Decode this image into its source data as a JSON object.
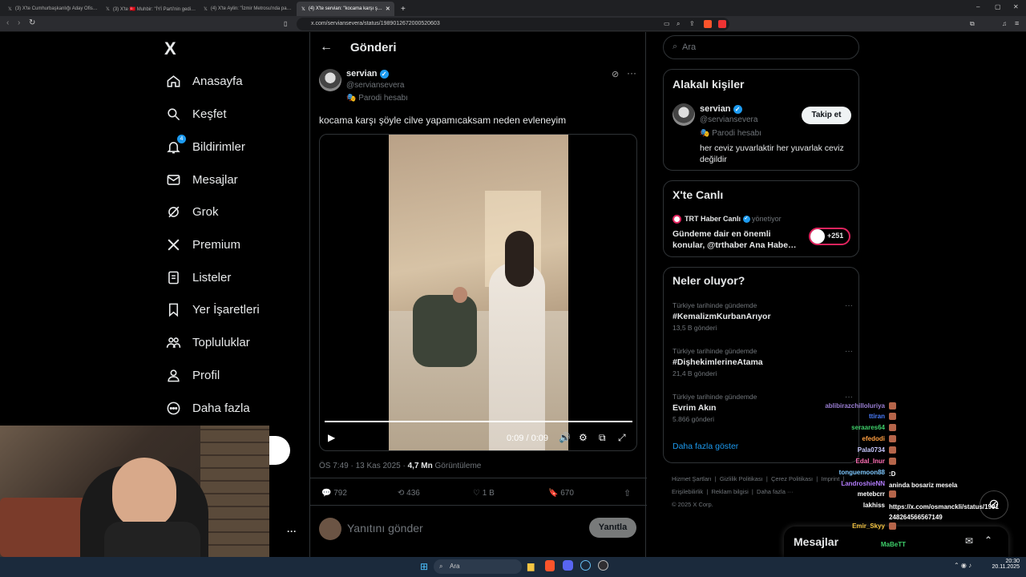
{
  "browser": {
    "tabs": [
      {
        "label": "(3) X'te Cumhurbaşkanlığı Aday Ofis…"
      },
      {
        "label": "(3) X'te  🇹🇷 Muhbir: \"İYİ Parti'nin gedi…"
      },
      {
        "label": "(4) X'te Aylin: \"İzmir Metrosu'nda pa…"
      },
      {
        "label": "(4) X'te servian: \"kocama karşı ş…"
      }
    ],
    "url": "x.com/serviansevera/status/1989012672000520603"
  },
  "nav": {
    "logo": "X",
    "items": [
      {
        "label": "Anasayfa",
        "icon": "home-icon"
      },
      {
        "label": "Keşfet",
        "icon": "search-icon"
      },
      {
        "label": "Bildirimler",
        "icon": "bell-icon",
        "badge": "4"
      },
      {
        "label": "Mesajlar",
        "icon": "mail-icon"
      },
      {
        "label": "Grok",
        "icon": "grok-icon"
      },
      {
        "label": "Premium",
        "icon": "x-icon"
      },
      {
        "label": "Listeler",
        "icon": "list-icon"
      },
      {
        "label": "Yer İşaretleri",
        "icon": "bookmark-icon"
      },
      {
        "label": "Topluluklar",
        "icon": "people-icon"
      },
      {
        "label": "Profil",
        "icon": "person-icon"
      },
      {
        "label": "Daha fazla",
        "icon": "more-circle-icon"
      }
    ]
  },
  "header": {
    "title": "Gönderi"
  },
  "post": {
    "name": "servian",
    "handle": "@serviansevera",
    "parody": "Parodi hesabı",
    "text": "kocama karşı şöyle cilve yapamıcaksam neden evleneyim",
    "video_time": "0:09 / 0:09",
    "video_progress": 1.0,
    "timestamp": "ÖS 7:49 · 13 Kas 2025 · ",
    "views": "4,7 Mn",
    "views_label": "Görüntüleme",
    "replies": "792",
    "reposts": "436",
    "likes": "1 B",
    "bookmarks": "670",
    "reply_placeholder": "Yanıtını gönder",
    "reply_button": "Yanıtla"
  },
  "search": {
    "placeholder": "Ara"
  },
  "related": {
    "title": "Alakalı kişiler",
    "name": "servian",
    "handle": "@serviansevera",
    "parody": "Parodi hesabı",
    "bio": "her ceviz yuvarlaktir her yuvarlak ceviz değildir",
    "follow": "Takip et"
  },
  "live": {
    "title": "X'te Canlı",
    "host": "TRT Haber Canlı",
    "host_role": "yönetiyor",
    "text": "Gündeme dair en önemli konular, @trthaber Ana Habe…",
    "count": "+251"
  },
  "trends": {
    "title": "Neler oluyor?",
    "items": [
      {
        "context": "Türkiye tarihinde gündemde",
        "name": "#KemalizmKurbanArıyor",
        "count": "13,5 B gönderi"
      },
      {
        "context": "Türkiye tarihinde gündemde",
        "name": "#DişhekimlerineAtama",
        "count": "21,4 B gönderi"
      },
      {
        "context": "Türkiye tarihinde gündemde",
        "name": "Evrim Akın",
        "count": "5.866 gönderi"
      }
    ],
    "show_more": "Daha fazla göster"
  },
  "footer": {
    "links": [
      "Hizmet Şartları",
      "Gizlilik Politikası",
      "Çerez Politikası",
      "Imprint",
      "Erişilebilirlik",
      "Reklam bilgisi",
      "Daha fazla ···"
    ],
    "copyright": "© 2025 X Corp."
  },
  "messages_bar": {
    "title": "Mesajlar"
  },
  "chat": [
    {
      "user": "ablibirazchilloluriya",
      "msg": "",
      "color": "#9b7fd4"
    },
    {
      "user": "ttiran",
      "msg": "",
      "color": "#4a7dff"
    },
    {
      "user": "seraares64",
      "msg": "",
      "color": "#3ecf6a"
    },
    {
      "user": "efedodi",
      "msg": "",
      "color": "#ff9f40"
    },
    {
      "user": "Pala0734",
      "msg": "",
      "color": "#c9c9ff"
    },
    {
      "user": "Edal_Inur",
      "msg": "",
      "color": "#ff6fb5"
    },
    {
      "user": "tonguemoon88",
      "msg": ":D",
      "color": "#7ec8ff"
    },
    {
      "user": "LandroshieNN",
      "msg": "aninda bosariz mesela",
      "color": "#b47dff"
    },
    {
      "user": "metebcrr",
      "msg": "",
      "color": "#ffffff"
    },
    {
      "user": "lakhiss",
      "msg": "https://x.com/osmanckli/status/1991 248264566567149",
      "color": "#ffffff"
    },
    {
      "user": "Emir_Skyy",
      "msg": "",
      "color": "#f5c542"
    },
    {
      "user": "MaBeTT",
      "msg": "",
      "color": "#3ecf6a"
    }
  ],
  "taskbar": {
    "search": "Ara",
    "time": "20:30",
    "date": "20.11.2025"
  }
}
